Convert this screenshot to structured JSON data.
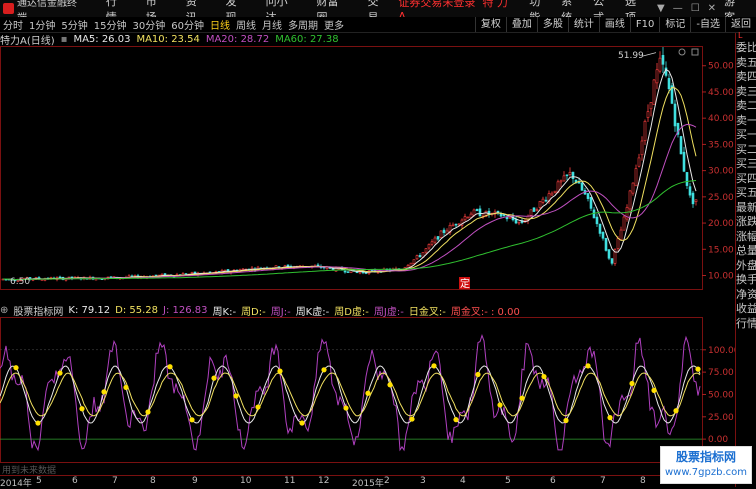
{
  "menubar": {
    "app_title": "通达信金融终端",
    "items": [
      "行情",
      "市场",
      "资讯",
      "发现",
      "问小达",
      "财富圈",
      "交易"
    ],
    "notice": "证券交易未登录",
    "stock_short": "特 力A",
    "right_items": [
      "功能",
      "系统",
      "公式",
      "选项",
      "游客"
    ],
    "window_buttons": [
      "▼",
      "—",
      "☐",
      "✕"
    ]
  },
  "toolbar": {
    "periods": [
      "分时",
      "1分钟",
      "5分钟",
      "15分钟",
      "30分钟",
      "60分钟",
      "日线",
      "周线",
      "月线",
      "多周期",
      "更多"
    ],
    "active_period": "日线",
    "tools": [
      "复权",
      "叠加",
      "多股",
      "统计",
      "画线",
      "F10",
      "标记",
      "-自选",
      "返回"
    ]
  },
  "main_header": {
    "title": "特力A(日线)",
    "ma5": "MA5: 26.03",
    "ma10": "MA10: 23.54",
    "ma20": "MA20: 28.72",
    "ma60": "MA60: 27.38",
    "colors": {
      "ma5": "#e8e8e8",
      "ma10": "#f0e060",
      "ma20": "#c050c0",
      "ma60": "#30c030"
    }
  },
  "main_chart": {
    "y_ticks": [
      "50.00",
      "45.00",
      "40.00",
      "35.00",
      "30.00",
      "25.00",
      "20.00",
      "15.00",
      "10.00"
    ],
    "y_values": [
      50,
      45,
      40,
      35,
      30,
      25,
      20,
      15,
      10
    ],
    "ylim": [
      8,
      53
    ],
    "high_label": "51.99",
    "low_label": "6.50",
    "marker_label": "定"
  },
  "sub_header": {
    "title": "股票指标网",
    "k": "K: 79.12",
    "d": "D: 55.28",
    "j": "J: 126.83",
    "items": [
      "周K:-",
      "周D:-",
      "周J:-",
      "周K虚:-",
      "周D虚:-",
      "周J虚:-",
      "日金叉:-",
      "周金叉:- : 0.00"
    ]
  },
  "sub_chart": {
    "y_ticks": [
      "100.00",
      "75.00",
      "50.00",
      "25.00",
      "0.00"
    ],
    "y_values": [
      100,
      75,
      50,
      25,
      0
    ],
    "ylim": [
      -20,
      130
    ]
  },
  "right_panel": {
    "labels": [
      "委比",
      "卖五",
      "卖四",
      "卖三",
      "卖二",
      "卖一",
      "买一",
      "买二",
      "买三",
      "买四",
      "买五",
      "最新",
      "涨跌",
      "涨幅",
      "总量",
      "外盘",
      "换手",
      "净资",
      "收益",
      "",
      "",
      "",
      "",
      "行情"
    ]
  },
  "x_axis": {
    "labels": [
      "2014年",
      "5",
      "6",
      "7",
      "8",
      "9",
      "10",
      "11",
      "12",
      "2015年",
      "2",
      "3",
      "4",
      "5",
      "6",
      "7",
      "8",
      "9"
    ]
  },
  "hint": "用到未来数据",
  "watermark": {
    "line1": "股票指标网",
    "line2": "www.7gpzb.com"
  }
}
